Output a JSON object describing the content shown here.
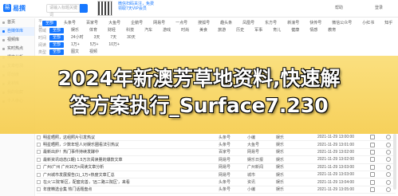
{
  "brand": {
    "name": "易撰"
  },
  "search": {
    "placeholder": "请输入标题关键词"
  },
  "filter_box": {
    "value": "请选择领域"
  },
  "notice": {
    "text": "微信扫码关注，免费领取7天VIP会员"
  },
  "top_right": {
    "links": [
      "帮助",
      "登录"
    ]
  },
  "sidebar": {
    "items": [
      {
        "label": "首页"
      },
      {
        "label": "自媒体库",
        "active": true
      },
      {
        "label": "视频库"
      },
      {
        "label": "实时热点"
      },
      {
        "label": "爆文分析"
      },
      {
        "label": "文章检测"
      },
      {
        "label": "原创度"
      },
      {
        "label": "素材库"
      },
      {
        "label": "我的收藏"
      },
      {
        "label": "个人中心"
      }
    ]
  },
  "filters": [
    {
      "label": "平台",
      "chips": [
        "全部",
        "头条号",
        "百家号",
        "大鱼号",
        "企鹅号",
        "网易号",
        "一点号",
        "搜狐号",
        "趣头条",
        "凤凰号",
        "东方号",
        "新浪号",
        "快传号",
        "微信公众号",
        "小红书",
        "知乎"
      ],
      "selected": 0
    },
    {
      "label": "领域",
      "chips": [
        "全部",
        "娱乐",
        "体育",
        "财经",
        "科技",
        "汽车",
        "游戏",
        "时尚",
        "美食",
        "旅游",
        "历史",
        "军事",
        "育儿",
        "健康",
        "情感",
        "教育"
      ],
      "selected": 0
    },
    {
      "label": "时间",
      "chips": [
        "全部",
        "24小时",
        "3天",
        "7天",
        "30天"
      ],
      "selected": 0
    },
    {
      "label": "阅读",
      "chips": [
        "全部",
        "1万+",
        "5万+",
        "10万+"
      ],
      "selected": 0
    },
    {
      "label": "类型",
      "chips": [
        "全部",
        "图文",
        "视频"
      ],
      "selected": 0
    }
  ],
  "headline": {
    "line1": "2024年新澳芳草地资料,快速解",
    "line2": "答方案执行_Surface7.230"
  },
  "table": {
    "rows": [
      {
        "title": "明星晒照，这组照片引发热议",
        "platform": "头条号",
        "field": "娱乐",
        "author": "小编",
        "date": "2021-11-29 13:00:00"
      },
      {
        "title": "明星晒照，少数年轻人对娱乐圈看法引热议",
        "platform": "头条号",
        "field": "娱乐",
        "author": "大鱼号",
        "date": "2021-11-29 13:01:00"
      },
      {
        "title": "最新出炉！热门事件持续发酵中",
        "platform": "百家号",
        "field": "娱乐",
        "author": "网易号",
        "date": "2021-11-29 13:02:00"
      },
      {
        "title": "最新资讯动态(1期) 1.5万次阅读量的爆款文章",
        "platform": "网易号",
        "field": "娱乐",
        "author": "娱乐日报",
        "date": "2021-11-29 13:02:00"
      },
      {
        "title": "广州/广州 广州10万+阅读文章分析",
        "platform": "网易号",
        "field": "娱乐",
        "author": "广州新闻",
        "date": "2021-11-29 13:03:00"
      },
      {
        "title": "广州城市发展报告(1)_1万+热度文章汇总",
        "platform": "网易号",
        "field": "娱乐",
        "author": "城市",
        "date": "2021-11-29 13:03:00"
      },
      {
        "title": "在火'三院'新区，配套完善，'远二路三院区'，来看",
        "platform": "头条号",
        "field": "娱乐",
        "author": "资讯",
        "date": "2021-11-29 13:04:00"
      },
      {
        "title": "年度精选合集 热门话题盘点",
        "platform": "头条号",
        "field": "娱乐",
        "author": "小编",
        "date": "2021-11-29 13:05:00"
      }
    ]
  }
}
